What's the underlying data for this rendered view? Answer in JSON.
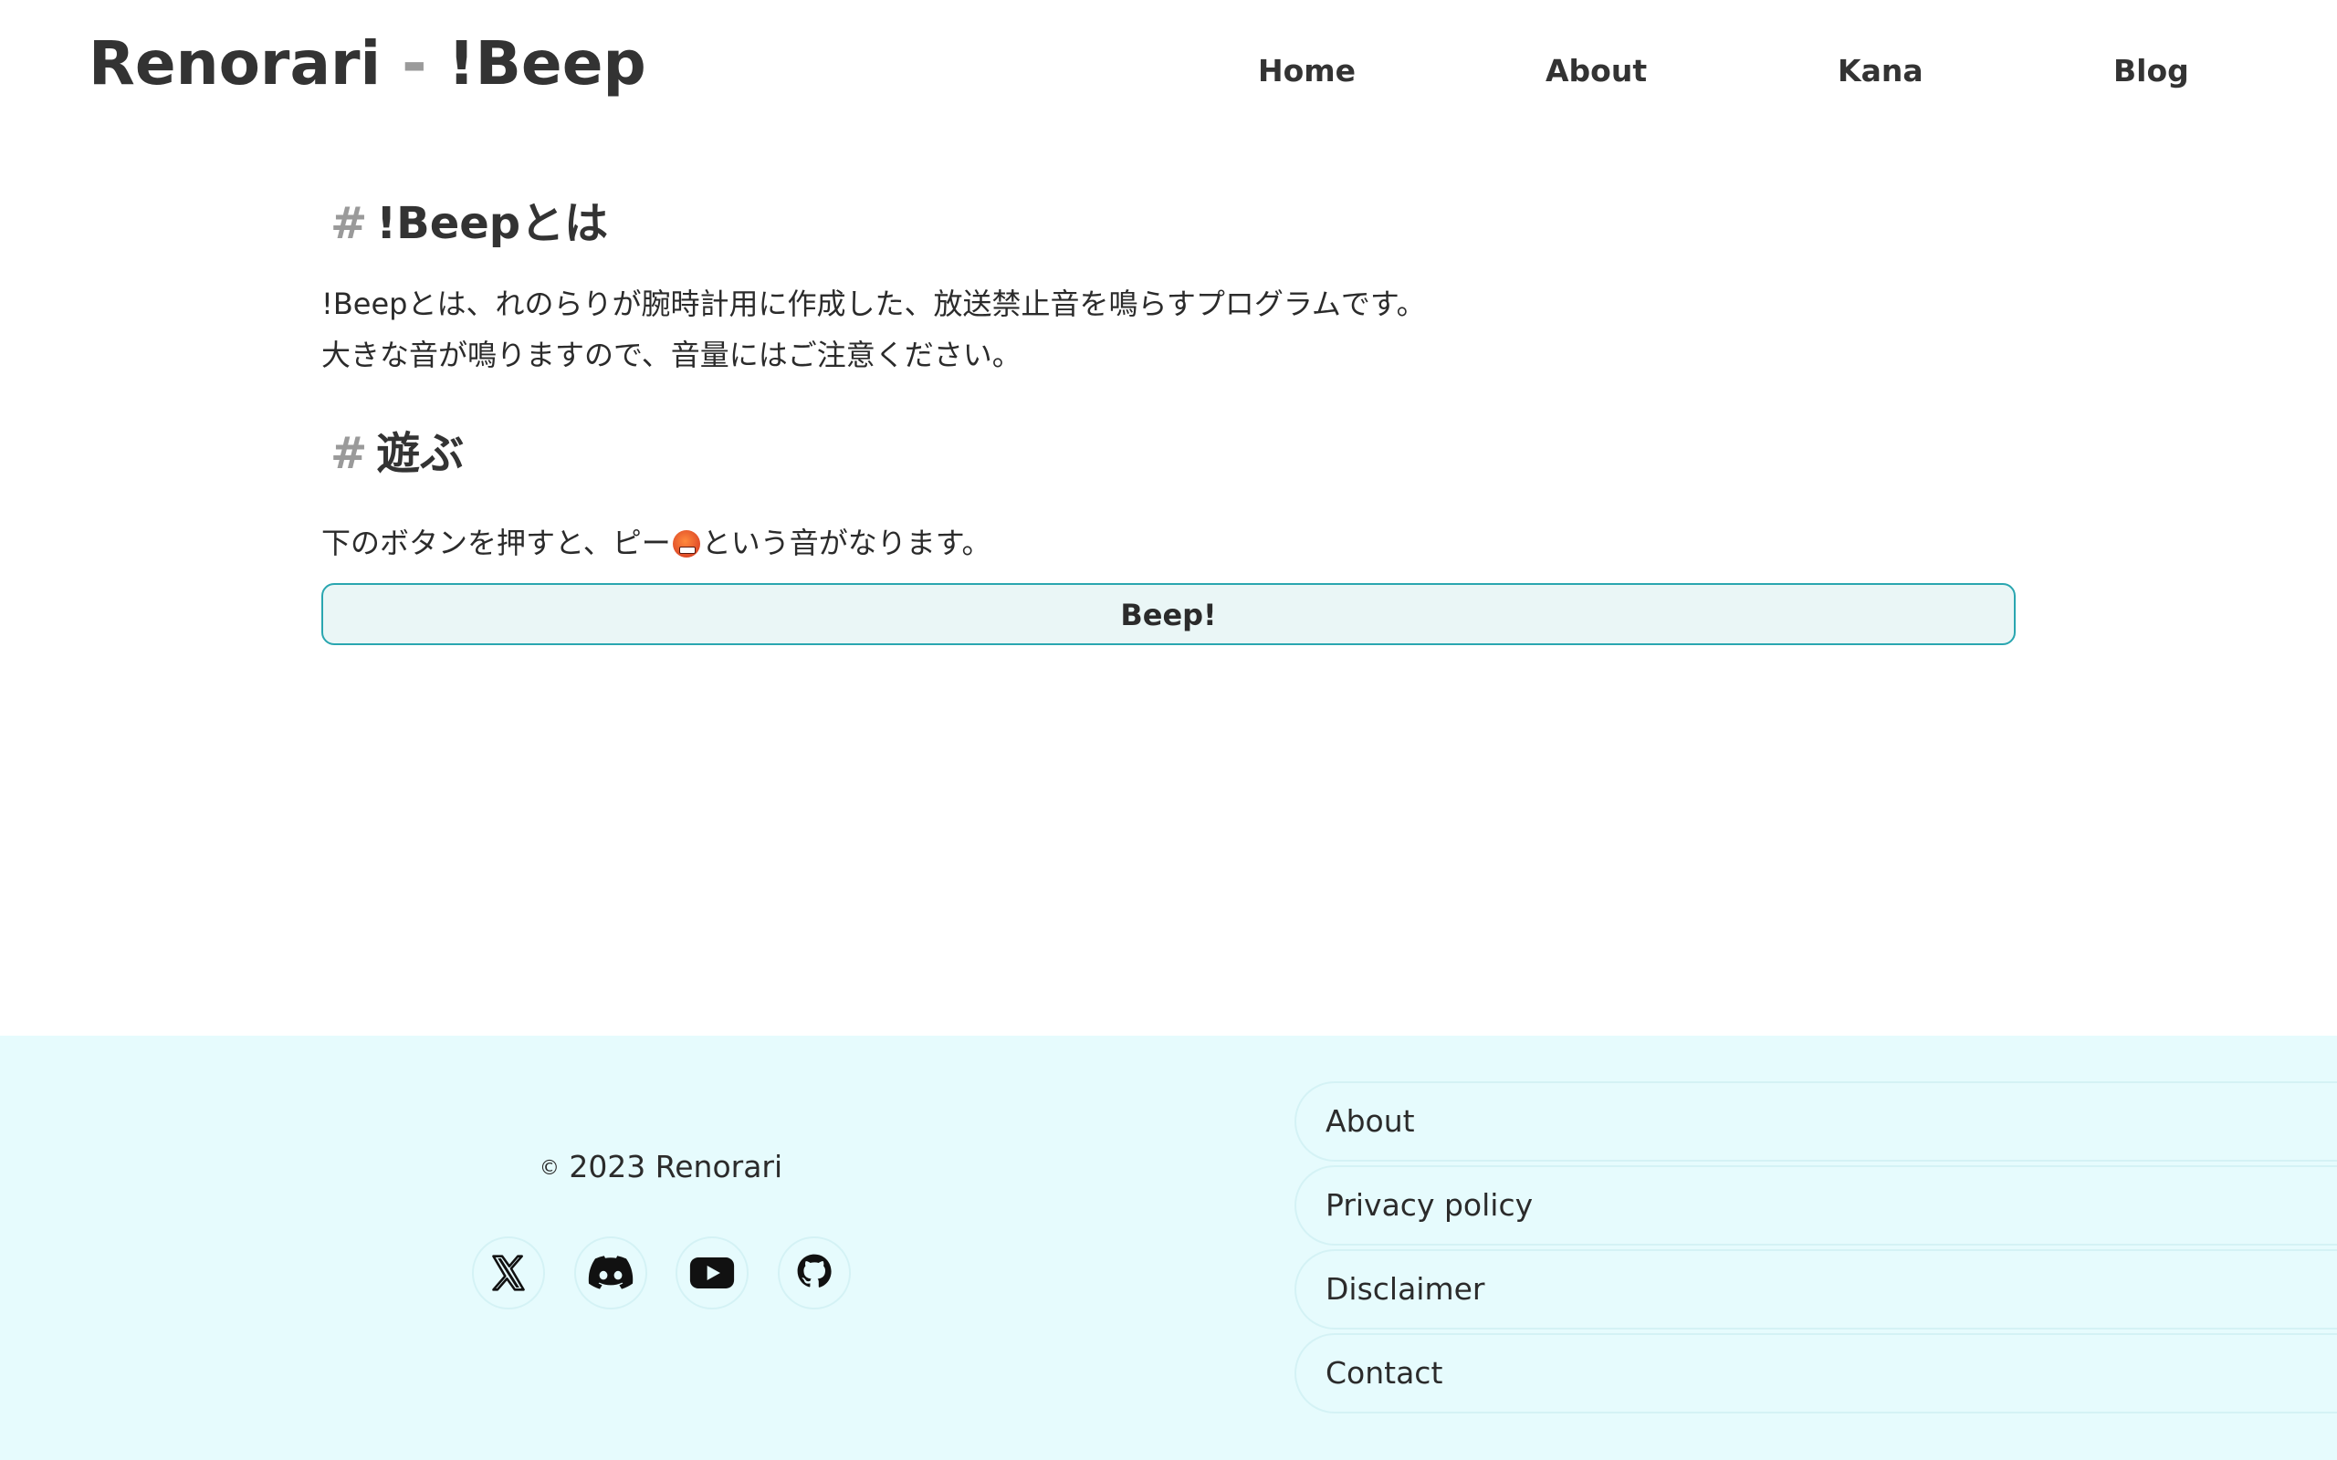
{
  "header": {
    "brand_main": "Renorari",
    "brand_sep": " - ",
    "brand_sub": "!Beep",
    "nav": [
      "Home",
      "About",
      "Kana",
      "Blog"
    ]
  },
  "main": {
    "section1": {
      "hash": "#",
      "title": "!Beepとは",
      "line1": "!Beepとは、れのらりが腕時計用に作成した、放送禁止音を鳴らすプログラムです。",
      "line2": "大きな音が鳴りますので、音量にはご注意ください。"
    },
    "section2": {
      "hash": "#",
      "title": "遊ぶ",
      "text_before": "下のボタンを押すと、ピー",
      "emoji_name": "face-with-symbols-on-mouth-icon",
      "text_after": "という音がなります。",
      "button_label": "Beep!"
    }
  },
  "footer": {
    "copyright_mark": "©",
    "copyright_text": " 2023 Renorari",
    "social": [
      "x-icon",
      "discord-icon",
      "youtube-icon",
      "github-icon"
    ],
    "links": [
      "About",
      "Privacy policy",
      "Disclaimer",
      "Contact"
    ]
  },
  "colors": {
    "text": "#2b2b2b",
    "muted": "#9a9a9a",
    "accent": "#2aa6b0",
    "button_bg": "#eaf6f6",
    "footer_bg": "#e6fbfd"
  }
}
